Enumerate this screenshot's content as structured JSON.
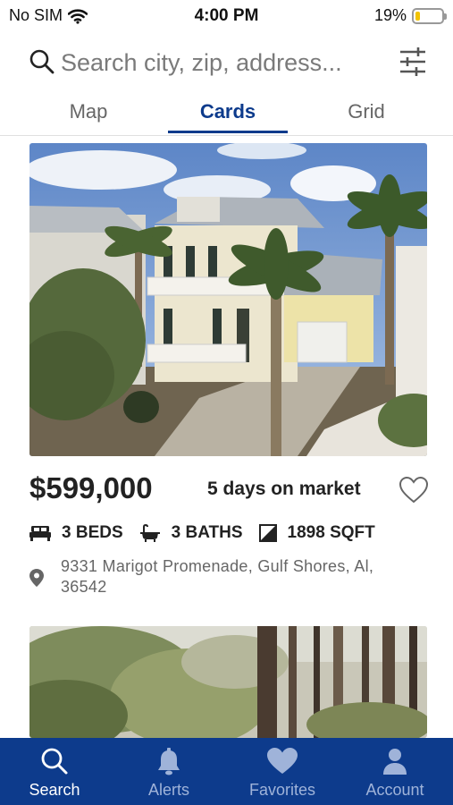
{
  "status_bar": {
    "carrier": "No SIM",
    "time": "4:00 PM",
    "battery_text": "19%",
    "battery_level": 0.19,
    "battery_color": "#f2c300"
  },
  "search": {
    "placeholder": "Search city, zip, address...",
    "icon": "search-icon",
    "filter_icon": "sliders-icon"
  },
  "tabs": [
    {
      "label": "Map",
      "active": false
    },
    {
      "label": "Cards",
      "active": true
    },
    {
      "label": "Grid",
      "active": false
    }
  ],
  "listings": [
    {
      "price": "$599,000",
      "days_on_market": "5 days on market",
      "favorite": false,
      "beds": "3 BEDS",
      "baths": "3 BATHS",
      "sqft": "1898 SQFT",
      "address": "9331 Marigot Promenade, Gulf Shores, Al, 36542"
    }
  ],
  "bottom_nav": [
    {
      "label": "Search",
      "icon": "search-icon",
      "active": true
    },
    {
      "label": "Alerts",
      "icon": "bell-icon",
      "active": false
    },
    {
      "label": "Favorites",
      "icon": "heart-icon",
      "active": false
    },
    {
      "label": "Account",
      "icon": "person-icon",
      "active": false
    }
  ],
  "colors": {
    "brand_blue": "#0d3b8c",
    "nav_inactive": "#9fb3d9"
  }
}
